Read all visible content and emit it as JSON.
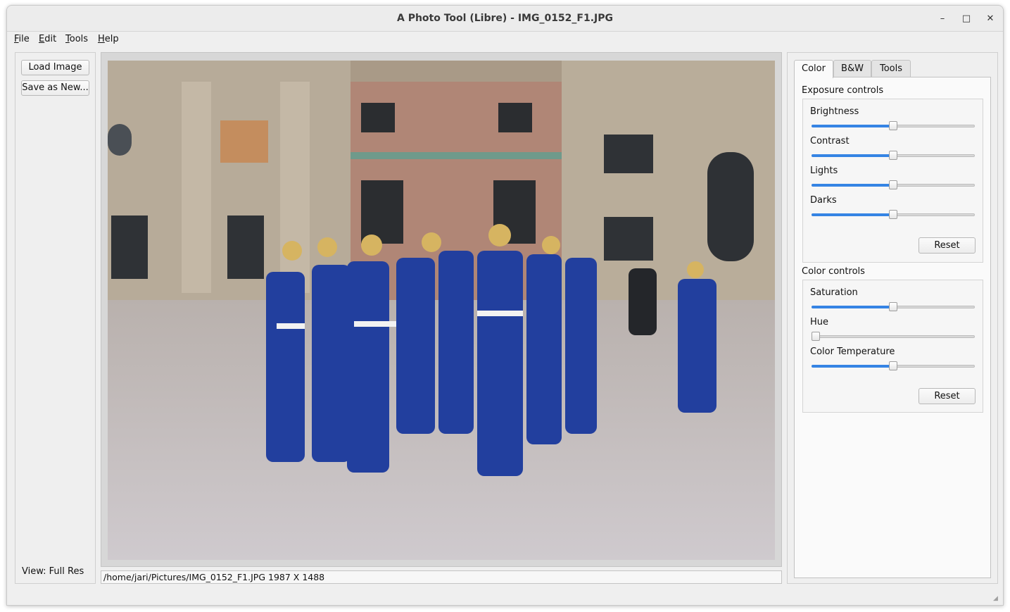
{
  "window": {
    "title": "A Photo Tool (Libre) - IMG_0152_F1.JPG",
    "minimize_glyph": "–",
    "maximize_glyph": "□",
    "close_glyph": "✕"
  },
  "menu": [
    {
      "accel": "F",
      "rest": "ile"
    },
    {
      "accel": "E",
      "rest": "dit"
    },
    {
      "accel": "T",
      "rest": "ools"
    },
    {
      "accel": "H",
      "rest": "elp"
    }
  ],
  "left_panel": {
    "load_label": "Load Image",
    "save_label": "Save as New...",
    "view_label": "View: Full Res"
  },
  "image": {
    "description_icon": "photo-canvas"
  },
  "status": {
    "text": "/home/jari/Pictures/IMG_0152_F1.JPG 1987 X 1488"
  },
  "tabs": [
    "Color",
    "B&W",
    "Tools"
  ],
  "active_tab": "Color",
  "exposure": {
    "title": "Exposure controls",
    "sliders": [
      {
        "label": "Brightness",
        "value": 0.5
      },
      {
        "label": "Contrast",
        "value": 0.5
      },
      {
        "label": "Lights",
        "value": 0.5
      },
      {
        "label": "Darks",
        "value": 0.5
      }
    ],
    "reset_label": "Reset"
  },
  "color": {
    "title": "Color controls",
    "sliders": [
      {
        "label": "Saturation",
        "value": 0.5
      },
      {
        "label": "Hue",
        "value": 0.0
      },
      {
        "label": "Color Temperature",
        "value": 0.5
      }
    ],
    "reset_label": "Reset"
  },
  "accent_color": "#3584e4"
}
